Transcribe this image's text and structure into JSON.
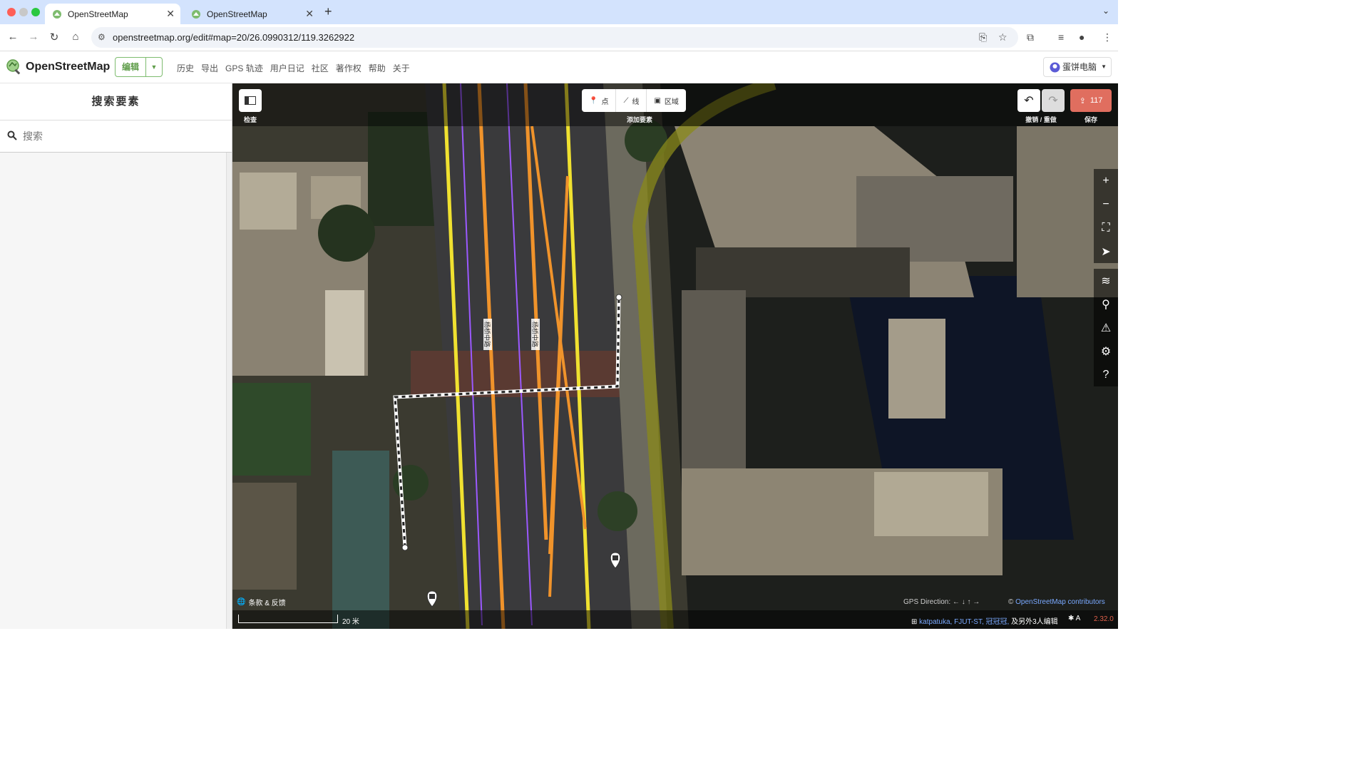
{
  "browser": {
    "tabs": [
      {
        "title": "OpenStreetMap",
        "active": true
      },
      {
        "title": "OpenStreetMap",
        "active": false
      }
    ],
    "url": "openstreetmap.org/edit#map=20/26.0990312/119.3262922"
  },
  "osm": {
    "brand": "OpenStreetMap",
    "edit_label": "编辑",
    "nav_links": [
      "历史",
      "导出",
      "GPS 轨迹",
      "用户日记",
      "社区",
      "著作权",
      "帮助",
      "关于"
    ],
    "user_name": "蛋饼电脑"
  },
  "sidebar": {
    "title": "搜索要素",
    "search_placeholder": "搜索"
  },
  "editor": {
    "inspect_label": "检查",
    "add_feature_label": "添加要素",
    "add_modes": [
      {
        "label": "点",
        "icon": "point-icon"
      },
      {
        "label": "线",
        "icon": "line-icon"
      },
      {
        "label": "区域",
        "icon": "area-icon"
      }
    ],
    "undo_redo_label": "撤销 / 重做",
    "save_label": "保存",
    "save_count": "117",
    "road_labels": [
      "杨桥中路",
      "杨桥中路"
    ],
    "terms_label": "条款 & 反馈",
    "scale_label": "20 米",
    "gps_direction": "GPS Direction:",
    "attribution_prefix": "©",
    "attribution_link": "OpenStreetMap contributors",
    "contributors": "katpatuka, FJUT-ST, 冠冠冠,",
    "contributors_more": "及另外3人编辑",
    "lang_label": "A",
    "version": "2.32.0"
  },
  "colors": {
    "osm_green": "#7ebc6f",
    "save_red": "#e06e5f",
    "primary_road": "#f0e130",
    "secondary_road": "#f0932b",
    "path": "#9b59ff"
  }
}
